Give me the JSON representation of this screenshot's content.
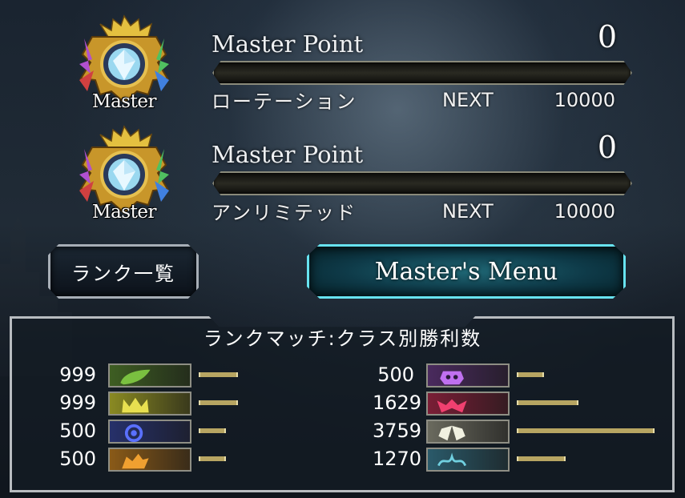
{
  "ranks": [
    {
      "badge_label": "Master",
      "title": "Master Point",
      "points": "0",
      "progress": 0,
      "mode": "ローテーション",
      "next_label": "NEXT",
      "next_value": "10000"
    },
    {
      "badge_label": "Master",
      "title": "Master Point",
      "points": "0",
      "progress": 0,
      "mode": "アンリミテッド",
      "next_label": "NEXT",
      "next_value": "10000"
    }
  ],
  "buttons": {
    "rank_list": "ランク一覧",
    "masters_menu": "Master's Menu"
  },
  "stats": {
    "title": "ランクマッチ:クラス別勝利数",
    "classes": [
      {
        "icon": "forestcraft-leaf-icon",
        "wins": "999",
        "value": 999,
        "color": "#3e5e22"
      },
      {
        "icon": "swordcraft-crown-icon",
        "wins": "999",
        "value": 999,
        "color": "#8a8a22"
      },
      {
        "icon": "runecraft-rune-icon",
        "wins": "500",
        "value": 500,
        "color": "#26306a"
      },
      {
        "icon": "dragoncraft-dragon-icon",
        "wins": "500",
        "value": 500,
        "color": "#8a5a18"
      },
      {
        "icon": "shadowcraft-skull-icon",
        "wins": "500",
        "value": 500,
        "color": "#4a2a5e"
      },
      {
        "icon": "bloodcraft-bat-icon",
        "wins": "1629",
        "value": 1629,
        "color": "#7a1e36"
      },
      {
        "icon": "havencraft-wings-icon",
        "wins": "3759",
        "value": 3759,
        "color": "#6a6a5e"
      },
      {
        "icon": "portalcraft-gear-icon",
        "wins": "1270",
        "value": 1270,
        "color": "#2a5a6a"
      }
    ]
  }
}
